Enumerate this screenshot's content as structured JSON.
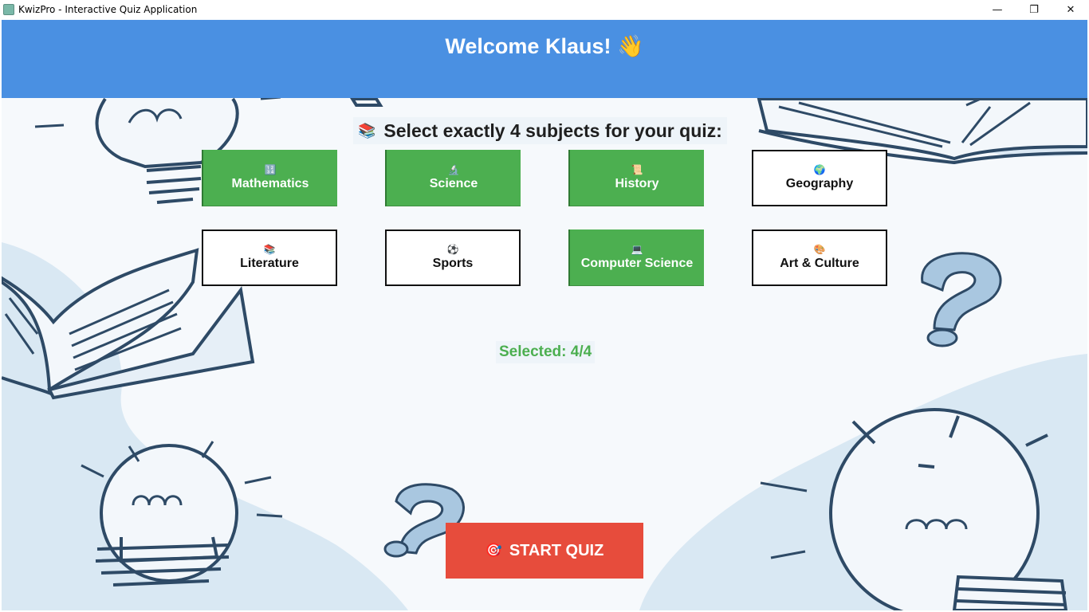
{
  "window": {
    "title": "KwizPro - Interactive Quiz Application",
    "minimize": "—",
    "maximize": "❐",
    "close": "✕"
  },
  "header": {
    "title": "Welcome Klaus! 👋",
    "bg_color": "#4a90e2"
  },
  "prompt": {
    "icon": "📚",
    "text": "Select exactly 4 subjects for your quiz:"
  },
  "subjects": [
    {
      "label": "Mathematics",
      "icon": "🔢",
      "icon_name": "calculator-icon",
      "selected": true
    },
    {
      "label": "Science",
      "icon": "🔬",
      "icon_name": "microscope-icon",
      "selected": true
    },
    {
      "label": "History",
      "icon": "📜",
      "icon_name": "scroll-icon",
      "selected": true
    },
    {
      "label": "Geography",
      "icon": "🌍",
      "icon_name": "globe-icon",
      "selected": false
    },
    {
      "label": "Literature",
      "icon": "📚",
      "icon_name": "books-icon",
      "selected": false
    },
    {
      "label": "Sports",
      "icon": "⚽",
      "icon_name": "soccer-ball-icon",
      "selected": false
    },
    {
      "label": "Computer Science",
      "icon": "💻",
      "icon_name": "laptop-icon",
      "selected": true
    },
    {
      "label": "Art & Culture",
      "icon": "🎨",
      "icon_name": "palette-icon",
      "selected": false
    }
  ],
  "selection": {
    "text": "Selected: 4/4",
    "color": "#4caf50"
  },
  "start_button": {
    "icon": "🎯",
    "label": "START QUIZ",
    "color": "#e74c3c"
  },
  "colors": {
    "selected": "#4caf50",
    "background_art": "#d6e6f2"
  }
}
